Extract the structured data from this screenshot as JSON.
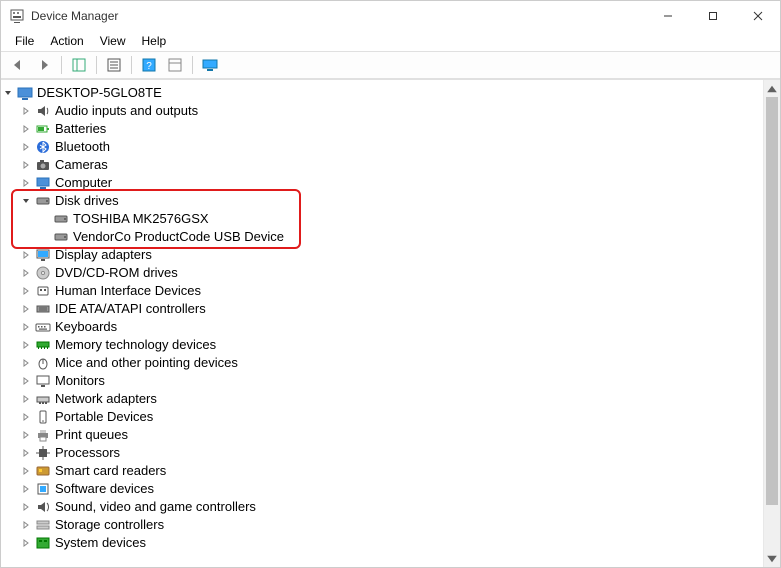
{
  "window": {
    "title": "Device Manager"
  },
  "menu": {
    "items": [
      "File",
      "Action",
      "View",
      "Help"
    ]
  },
  "tree": {
    "root": "DESKTOP-5GLO8TE",
    "nodes": [
      {
        "label": "Audio inputs and outputs",
        "icon": "audio",
        "expanded": false
      },
      {
        "label": "Batteries",
        "icon": "battery",
        "expanded": false
      },
      {
        "label": "Bluetooth",
        "icon": "bluetooth",
        "expanded": false
      },
      {
        "label": "Cameras",
        "icon": "camera",
        "expanded": false
      },
      {
        "label": "Computer",
        "icon": "computer",
        "expanded": false
      },
      {
        "label": "Disk drives",
        "icon": "disk",
        "expanded": true,
        "children": [
          {
            "label": "TOSHIBA MK2576GSX",
            "icon": "disk"
          },
          {
            "label": "VendorCo ProductCode USB Device",
            "icon": "disk"
          }
        ]
      },
      {
        "label": "Display adapters",
        "icon": "display",
        "expanded": false
      },
      {
        "label": "DVD/CD-ROM drives",
        "icon": "dvd",
        "expanded": false
      },
      {
        "label": "Human Interface Devices",
        "icon": "hid",
        "expanded": false
      },
      {
        "label": "IDE ATA/ATAPI controllers",
        "icon": "ide",
        "expanded": false
      },
      {
        "label": "Keyboards",
        "icon": "keyboard",
        "expanded": false
      },
      {
        "label": "Memory technology devices",
        "icon": "memory",
        "expanded": false
      },
      {
        "label": "Mice and other pointing devices",
        "icon": "mouse",
        "expanded": false
      },
      {
        "label": "Monitors",
        "icon": "monitor",
        "expanded": false
      },
      {
        "label": "Network adapters",
        "icon": "network",
        "expanded": false
      },
      {
        "label": "Portable Devices",
        "icon": "portable",
        "expanded": false
      },
      {
        "label": "Print queues",
        "icon": "printer",
        "expanded": false
      },
      {
        "label": "Processors",
        "icon": "cpu",
        "expanded": false
      },
      {
        "label": "Smart card readers",
        "icon": "smartcard",
        "expanded": false
      },
      {
        "label": "Software devices",
        "icon": "software",
        "expanded": false
      },
      {
        "label": "Sound, video and game controllers",
        "icon": "sound",
        "expanded": false
      },
      {
        "label": "Storage controllers",
        "icon": "storage",
        "expanded": false
      },
      {
        "label": "System devices",
        "icon": "system",
        "expanded": false
      }
    ]
  }
}
